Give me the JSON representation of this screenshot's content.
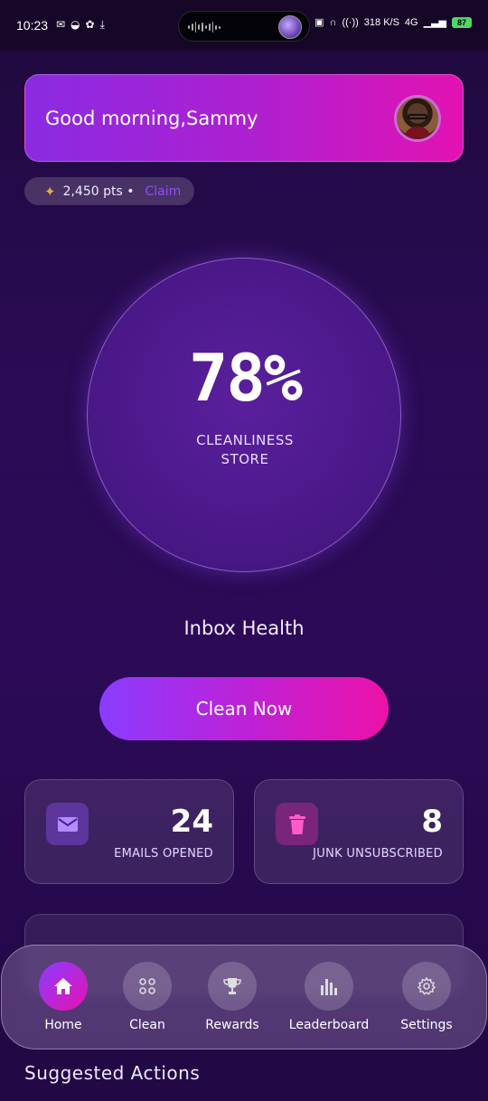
{
  "status_bar": {
    "time": "10:23",
    "speed": "318 K/S",
    "network": "4G",
    "battery": "87"
  },
  "greeting": {
    "text": "Good morning,Sammy"
  },
  "points": {
    "value": "2,450 pts •",
    "claim_label": "Claim"
  },
  "health": {
    "percent": "78%",
    "label_line1": "CLEANLINESS",
    "label_line2": "STORE",
    "title": "Inbox Health"
  },
  "actions": {
    "clean_now": "Clean Now"
  },
  "stats": [
    {
      "value": "24",
      "label": "EMAILS OPENED",
      "icon": "mail-icon"
    },
    {
      "value": "8",
      "label": "JUNK UNSUBSCRIBED",
      "icon": "trash-icon"
    }
  ],
  "nav": {
    "items": [
      {
        "label": "Home",
        "icon": "home-icon",
        "active": true
      },
      {
        "label": "Clean",
        "icon": "grid-icon"
      },
      {
        "label": "Rewards",
        "icon": "trophy-icon"
      },
      {
        "label": "Leaderboard",
        "icon": "bar-chart-icon"
      },
      {
        "label": "Settings",
        "icon": "gear-icon"
      }
    ]
  },
  "section": {
    "suggested_title": "Suggested Actions"
  },
  "colors": {
    "accent_purple": "#8a3cff",
    "accent_pink": "#ec12a8",
    "background": "#2a0b55"
  }
}
